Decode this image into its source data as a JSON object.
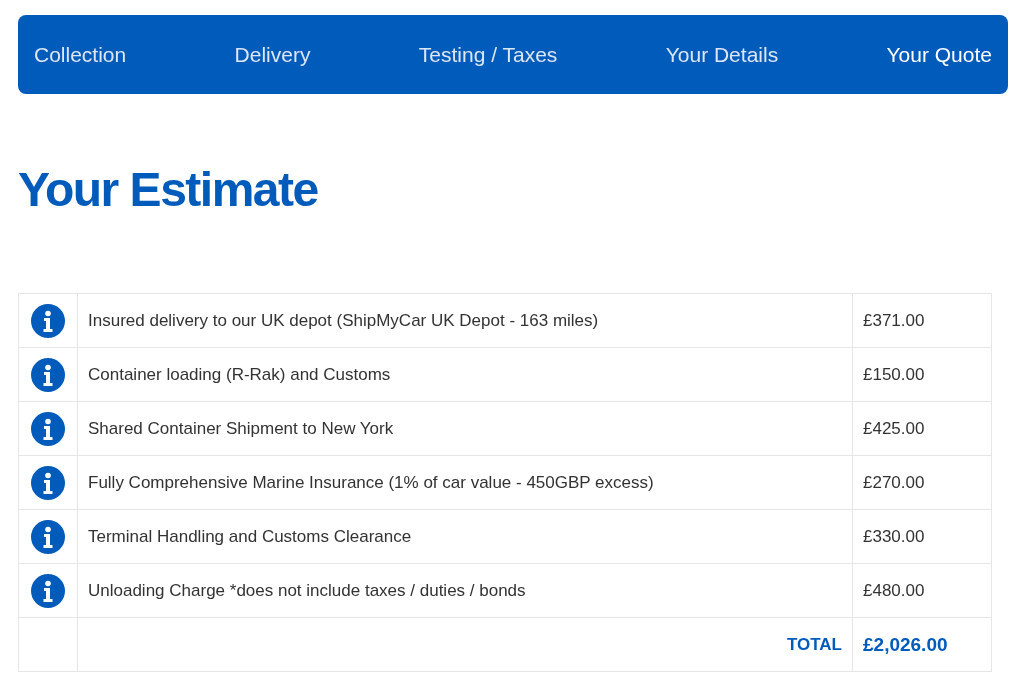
{
  "tabs": [
    {
      "label": "Collection",
      "selected": false
    },
    {
      "label": "Delivery",
      "selected": false
    },
    {
      "label": "Testing / Taxes",
      "selected": false
    },
    {
      "label": "Your Details",
      "selected": false
    },
    {
      "label": "Your Quote",
      "selected": true
    }
  ],
  "heading": "Your Estimate",
  "rows": [
    {
      "description": "Insured delivery to our UK depot (ShipMyCar UK Depot - 163 miles)",
      "price": "£371.00"
    },
    {
      "description": "Container loading (R-Rak) and Customs",
      "price": "£150.00"
    },
    {
      "description": "Shared Container Shipment to New York",
      "price": "£425.00"
    },
    {
      "description": "Fully Comprehensive Marine Insurance (1% of car value - 450GBP excess)",
      "price": "£270.00"
    },
    {
      "description": "Terminal Handling and Customs Clearance",
      "price": "£330.00"
    },
    {
      "description": "Unloading Charge *does not include taxes / duties / bonds",
      "price": "£480.00"
    }
  ],
  "total": {
    "label": "TOTAL",
    "value": "£2,026.00"
  }
}
